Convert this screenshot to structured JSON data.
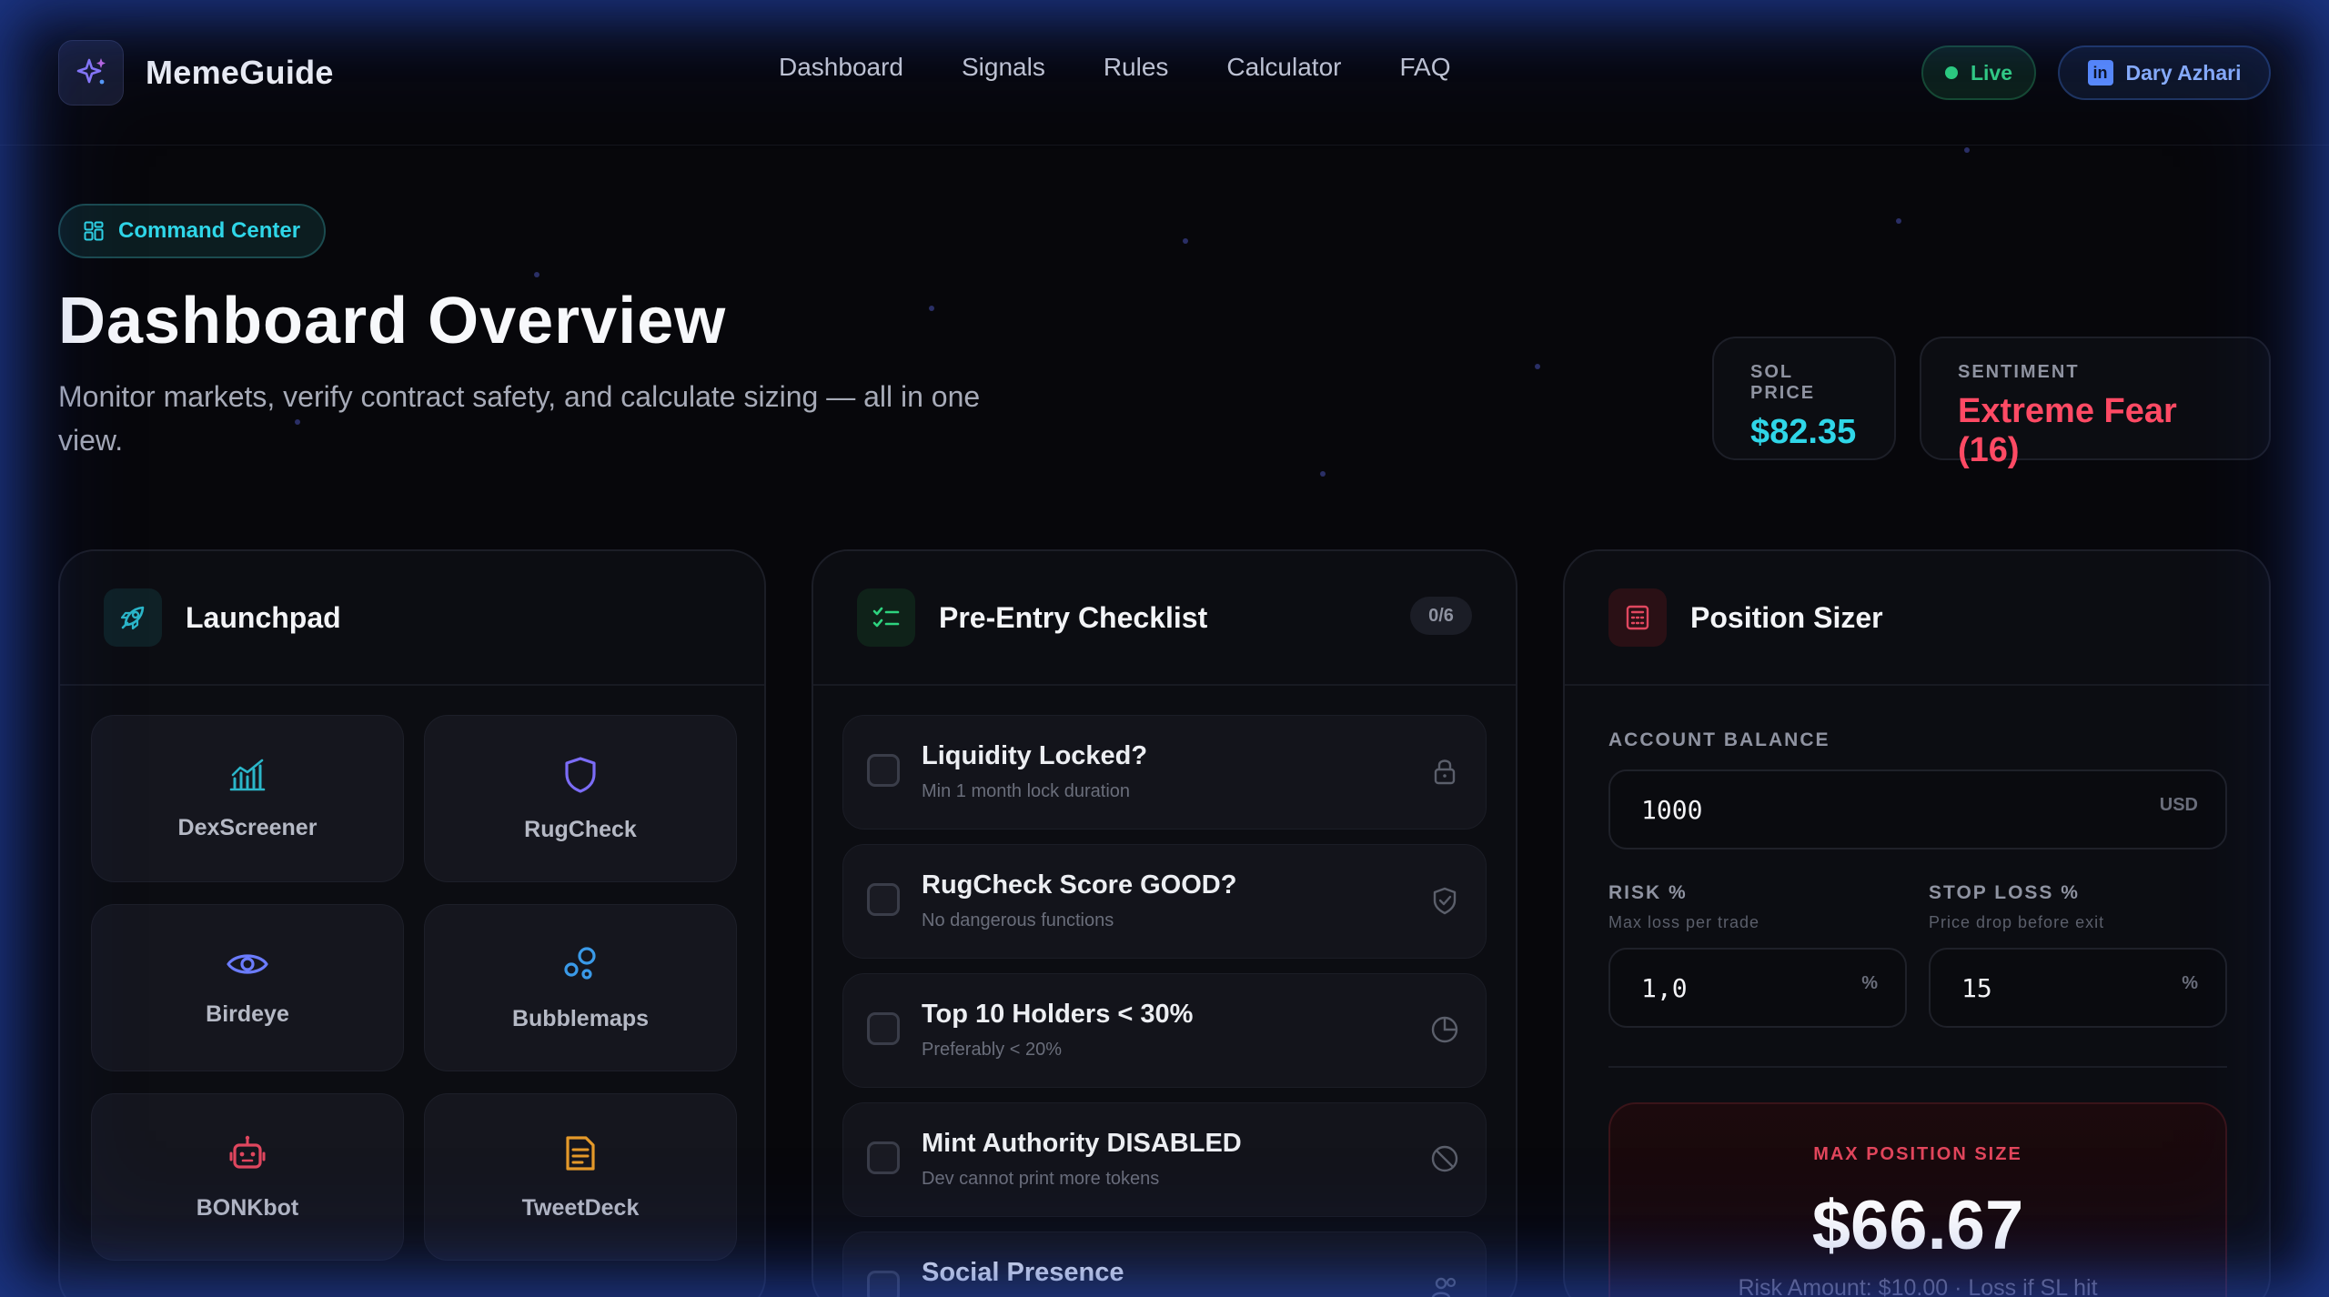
{
  "app": {
    "name": "MemeGuide",
    "logo_icon": "sparkles-icon"
  },
  "nav": [
    "Dashboard",
    "Signals",
    "Rules",
    "Calculator",
    "FAQ"
  ],
  "status": {
    "live_label": "Live",
    "live_color": "#2ed37f"
  },
  "user": {
    "name": "Dary Azhari",
    "icon": "linkedin-icon"
  },
  "hero": {
    "badge": "Command Center",
    "title": "Dashboard Overview",
    "subtitle": "Monitor markets, verify contract safety, and calculate sizing — all in one view."
  },
  "stats": {
    "sol_label": "SOL PRICE",
    "sol_value": "$82.35",
    "sol_color": "#2fd6e8",
    "sentiment_label": "SENTIMENT",
    "sentiment_value": "Extreme Fear (16)",
    "sentiment_color": "#ff4a64"
  },
  "launchpad": {
    "title": "Launchpad",
    "tiles": [
      {
        "label": "DexScreener",
        "icon": "chart-icon",
        "color": "#2bb6c9"
      },
      {
        "label": "RugCheck",
        "icon": "shield-icon",
        "color": "#7b6cf6"
      },
      {
        "label": "Birdeye",
        "icon": "eye-icon",
        "color": "#6b7cff"
      },
      {
        "label": "Bubblemaps",
        "icon": "bubbles-icon",
        "color": "#3a9ae8"
      },
      {
        "label": "BONKbot",
        "icon": "robot-icon",
        "color": "#e0475f"
      },
      {
        "label": "TweetDeck",
        "icon": "document-icon",
        "color": "#e59a2a"
      }
    ]
  },
  "checklist": {
    "title": "Pre-Entry Checklist",
    "count": "0/6",
    "items": [
      {
        "title": "Liquidity Locked?",
        "sub": "Min 1 month lock duration",
        "icon": "lock-icon"
      },
      {
        "title": "RugCheck Score GOOD?",
        "sub": "No dangerous functions",
        "icon": "shield-check-icon"
      },
      {
        "title": "Top 10 Holders < 30%",
        "sub": "Preferably < 20%",
        "icon": "pie-icon"
      },
      {
        "title": "Mint Authority DISABLED",
        "sub": "Dev cannot print more tokens",
        "icon": "ban-icon"
      },
      {
        "title": "Social Presence",
        "sub": "",
        "icon": "users-icon"
      }
    ]
  },
  "sizer": {
    "title": "Position Sizer",
    "balance_label": "ACCOUNT BALANCE",
    "balance_value": "1000",
    "balance_unit": "USD",
    "risk_label": "RISK %",
    "risk_hint": "Max loss per trade",
    "risk_value": "1,0",
    "risk_unit": "%",
    "stop_label": "STOP LOSS %",
    "stop_hint": "Price drop before exit",
    "stop_value": "15",
    "stop_unit": "%",
    "result_label": "MAX POSITION SIZE",
    "result_value": "$66.67",
    "result_note": "Risk Amount: $10.00 · Loss if SL hit"
  }
}
